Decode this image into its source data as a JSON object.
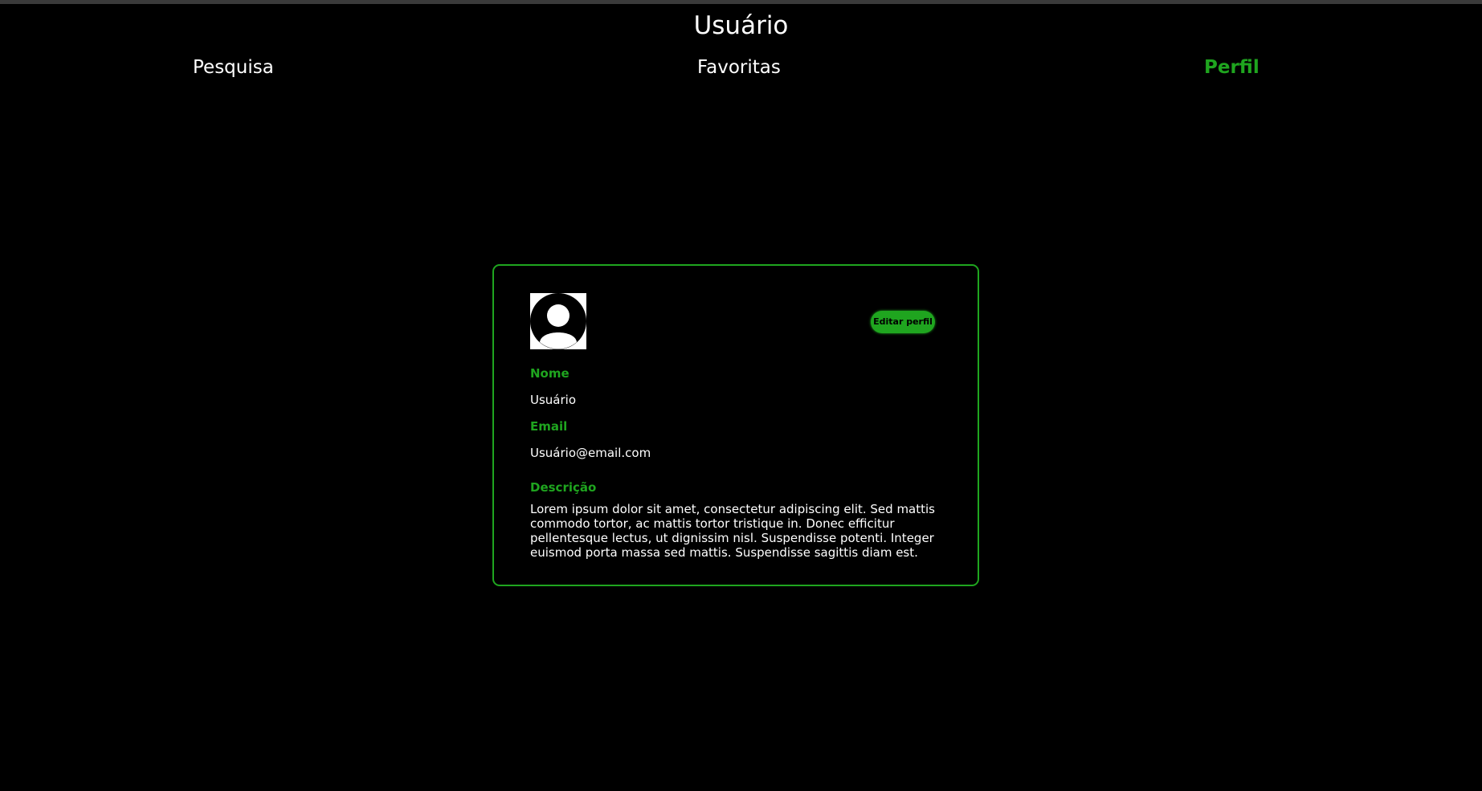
{
  "header": {
    "title": "Usuário"
  },
  "nav": {
    "items": [
      {
        "label": "Pesquisa",
        "active": false
      },
      {
        "label": "Favoritas",
        "active": false
      },
      {
        "label": "Perfil",
        "active": true
      }
    ]
  },
  "profile": {
    "avatar_icon": "user-avatar-icon",
    "edit_button_label": "Editar perfil",
    "fields": {
      "name_label": "Nome",
      "name_value": "Usuário",
      "email_label": "Email",
      "email_value": "Usuário@email.com",
      "description_label": "Descrição",
      "description_value": "Lorem ipsum dolor sit amet, consectetur adipiscing elit. Sed mattis commodo tortor, ac mattis tortor tristique in. Donec efficitur pellentesque lectus, ut dignissim nisl. Suspendisse potenti. Integer euismod porta massa sed mattis. Suspendisse sagittis diam est."
    }
  },
  "colors": {
    "accent": "#1fa51f",
    "background": "#000000",
    "text": "#ffffff"
  }
}
